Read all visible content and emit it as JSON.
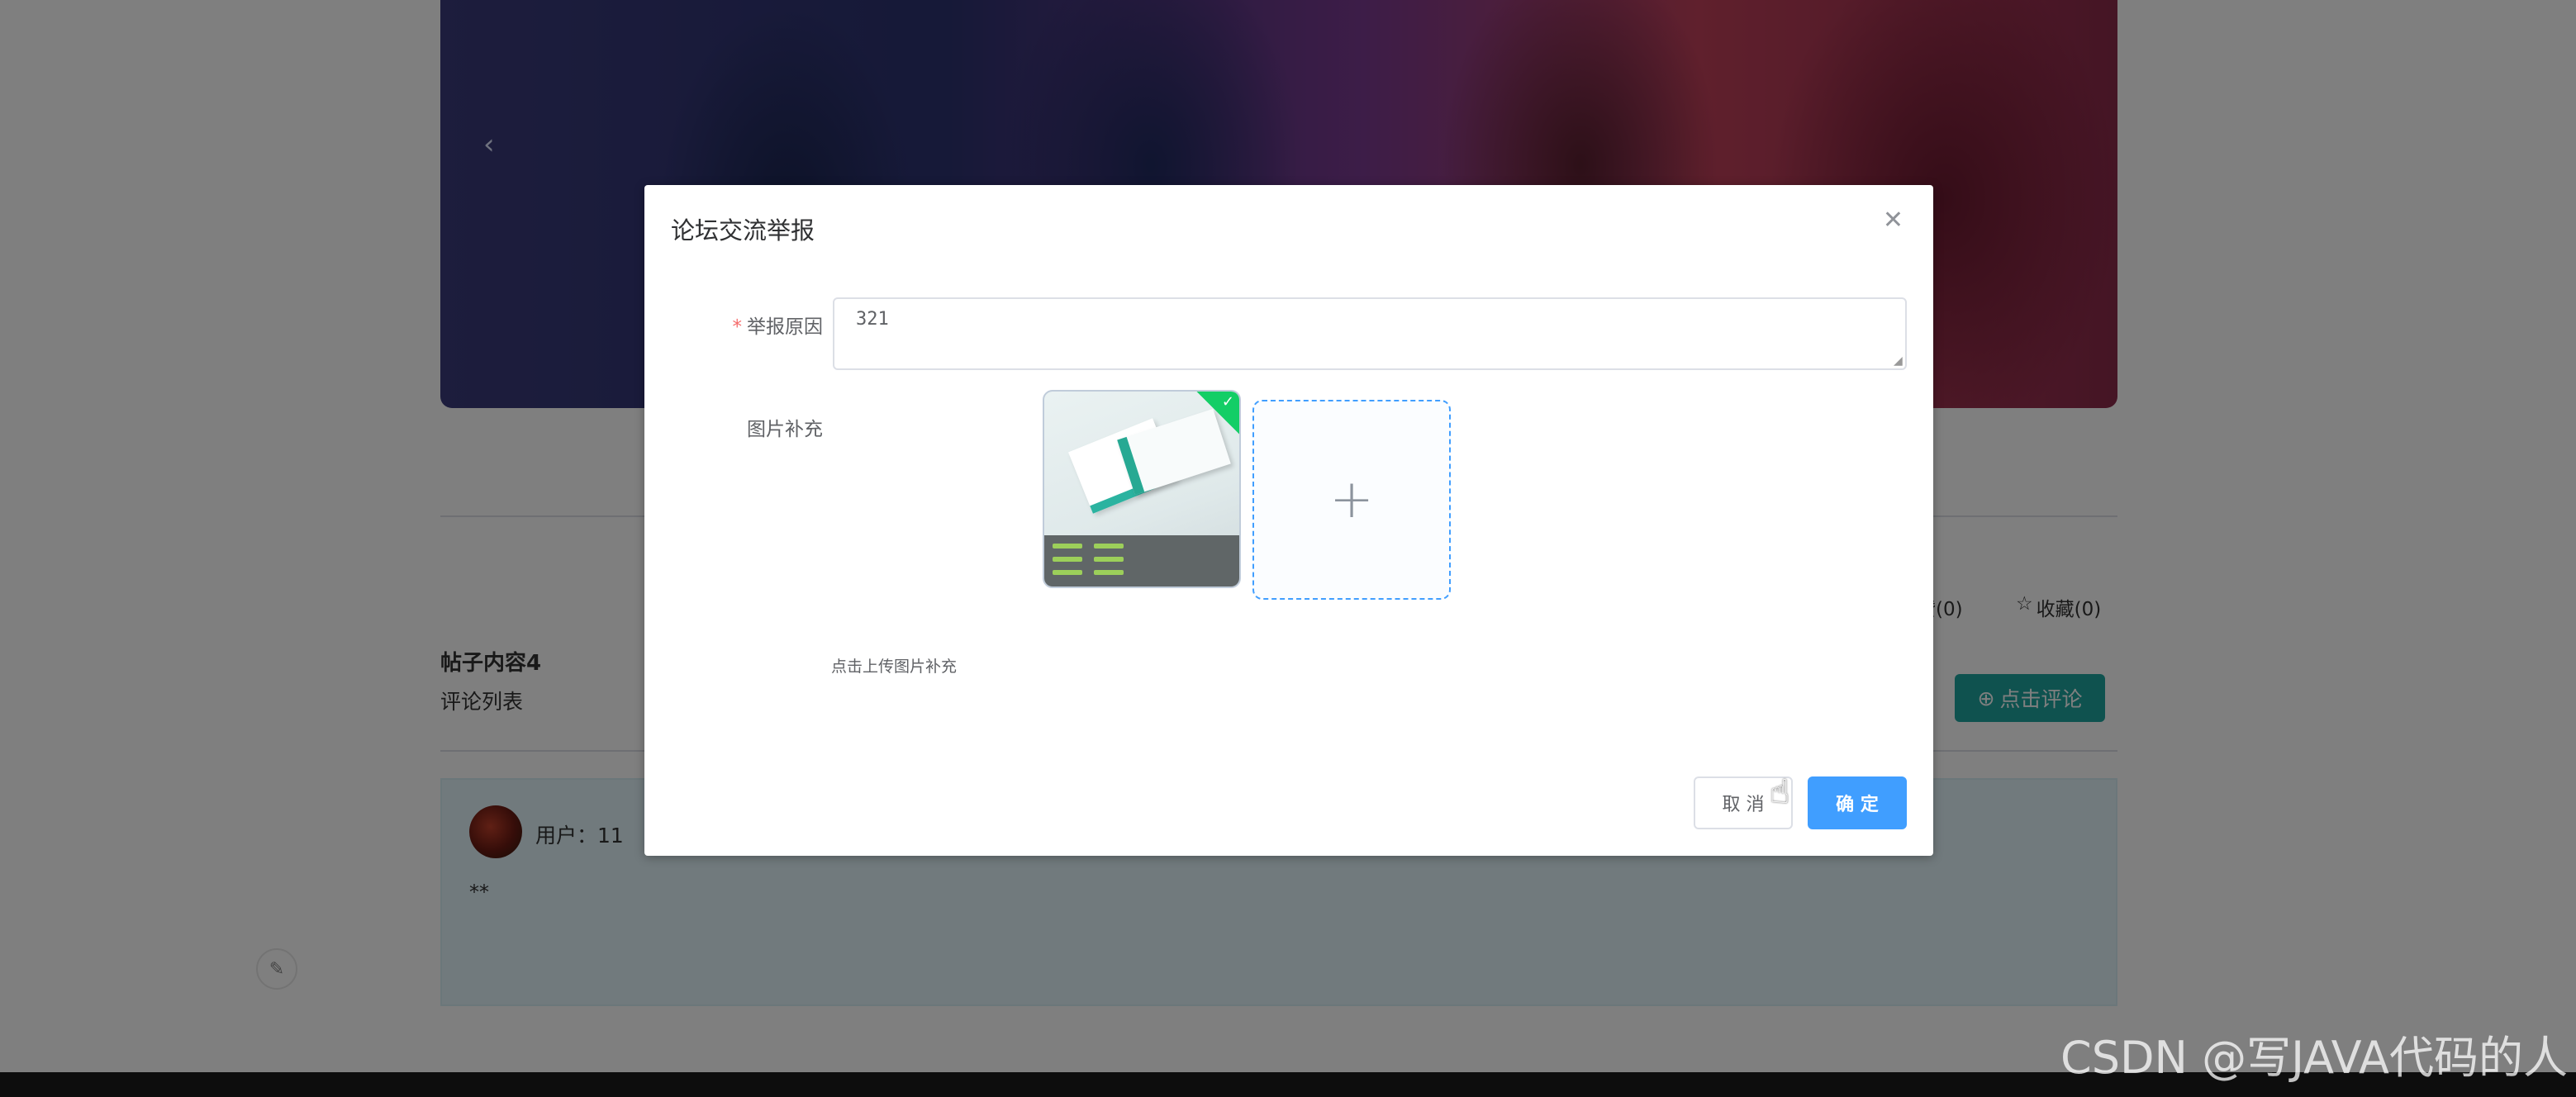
{
  "background": {
    "banner_arrow": "‹",
    "post_title": "帖子内容4",
    "comment_list_label": "评论列表",
    "like_count": "赞(0)",
    "favorite_count": "收藏(0)",
    "comment_button": "点击评论",
    "comment": {
      "user_label": "用户：11",
      "content": "**"
    },
    "watermark": "CSDN @写JAVA代码的人"
  },
  "dialog": {
    "title": "论坛交流举报",
    "close_icon": "close-icon",
    "fields": {
      "reason_label": "举报原因",
      "reason_required_mark": "*",
      "reason_value": "321",
      "image_label": "图片补充",
      "upload_tip": "点击上传图片补充"
    },
    "buttons": {
      "cancel": "取 消",
      "confirm": "确 定"
    }
  },
  "colors": {
    "primary": "#409eff",
    "success": "#13ce66",
    "teal_button": "#1fa59f",
    "required": "#f56c6c"
  }
}
